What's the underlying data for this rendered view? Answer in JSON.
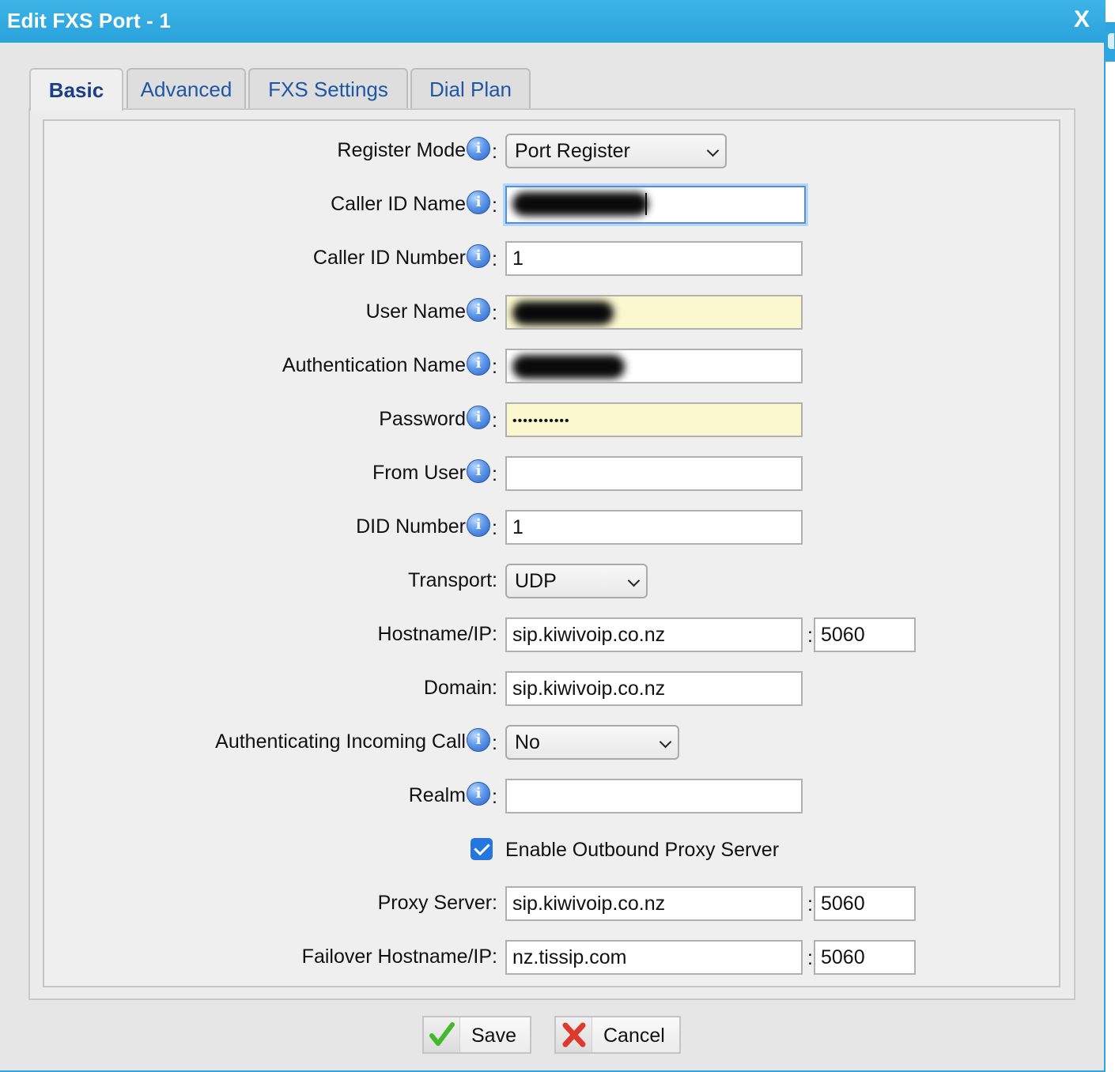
{
  "dialog": {
    "title": "Edit FXS Port - 1",
    "close_label": "X"
  },
  "tabs": [
    {
      "label": "Basic",
      "active": true
    },
    {
      "label": "Advanced",
      "active": false
    },
    {
      "label": "FXS Settings",
      "active": false
    },
    {
      "label": "Dial Plan",
      "active": false
    }
  ],
  "form": {
    "register_mode": {
      "label": "Register Mode",
      "value": "Port Register"
    },
    "caller_id_name": {
      "label": "Caller ID Name",
      "value": "",
      "redacted": true
    },
    "caller_id_number": {
      "label": "Caller ID Number",
      "value": "1"
    },
    "user_name": {
      "label": "User Name",
      "value": "",
      "redacted": true
    },
    "authentication_name": {
      "label": "Authentication Name",
      "value": "",
      "redacted": true
    },
    "password": {
      "label": "Password",
      "value": "•••••••••••"
    },
    "from_user": {
      "label": "From User",
      "value": ""
    },
    "did_number": {
      "label": "DID Number",
      "value": "1"
    },
    "transport": {
      "label": "Transport:",
      "value": "UDP"
    },
    "hostname": {
      "label": "Hostname/IP:",
      "value": "sip.kiwivoip.co.nz",
      "port": "5060"
    },
    "domain": {
      "label": "Domain:",
      "value": "sip.kiwivoip.co.nz"
    },
    "auth_incoming": {
      "label": "Authenticating Incoming Call",
      "value": "No"
    },
    "realm": {
      "label": "Realm",
      "value": ""
    },
    "outbound_proxy": {
      "label": "Enable Outbound Proxy Server",
      "checked": true
    },
    "proxy_server": {
      "label": "Proxy Server:",
      "value": "sip.kiwivoip.co.nz",
      "port": "5060"
    },
    "failover_hostname": {
      "label": "Failover Hostname/IP:",
      "value": "nz.tissip.com",
      "port": "5060"
    }
  },
  "footer": {
    "save_label": "Save",
    "cancel_label": "Cancel"
  },
  "icons": {
    "info": "info-icon",
    "save": "checkmark-icon",
    "cancel": "x-mark-icon",
    "chevron": "chevron-down-icon"
  },
  "colors": {
    "titlebar": "#2fa5df",
    "tab_text": "#1f57a4",
    "autofill_yellow": "#fbf7cf",
    "checkbox": "#2477df",
    "save_icon": "#46b82c",
    "cancel_icon": "#e0382f"
  }
}
